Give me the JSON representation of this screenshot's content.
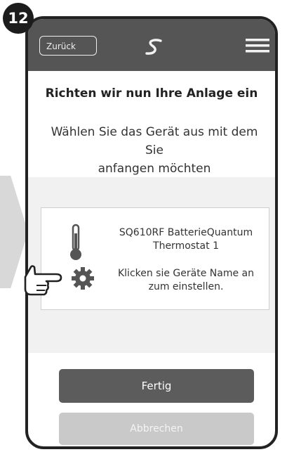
{
  "step": {
    "number": "12"
  },
  "header": {
    "back_label": "Zurück",
    "logo_icon": "s-logo-icon",
    "menu_icon": "hamburger-menu-icon"
  },
  "main": {
    "title": "Richten wir nun Ihre Anlage ein",
    "subtitle_line1": "Wählen Sie das Gerät aus mit dem Sie",
    "subtitle_line2": "anfangen möchten"
  },
  "device": {
    "name_line1": "SQ610RF BatterieQuantum",
    "name_line2": "Thermostat 1",
    "hint_line1": "Klicken sie Geräte Name an",
    "hint_line2": "zum einstellen.",
    "icons": [
      "thermometer-icon",
      "gear-icon"
    ]
  },
  "buttons": {
    "done_label": "Fertig",
    "cancel_label": "Abbrechen"
  },
  "colors": {
    "header_bg": "#555555",
    "done_bg": "#5c5c5c",
    "cancel_bg": "#c9c9c9",
    "content_bg": "#f1f1f1"
  }
}
